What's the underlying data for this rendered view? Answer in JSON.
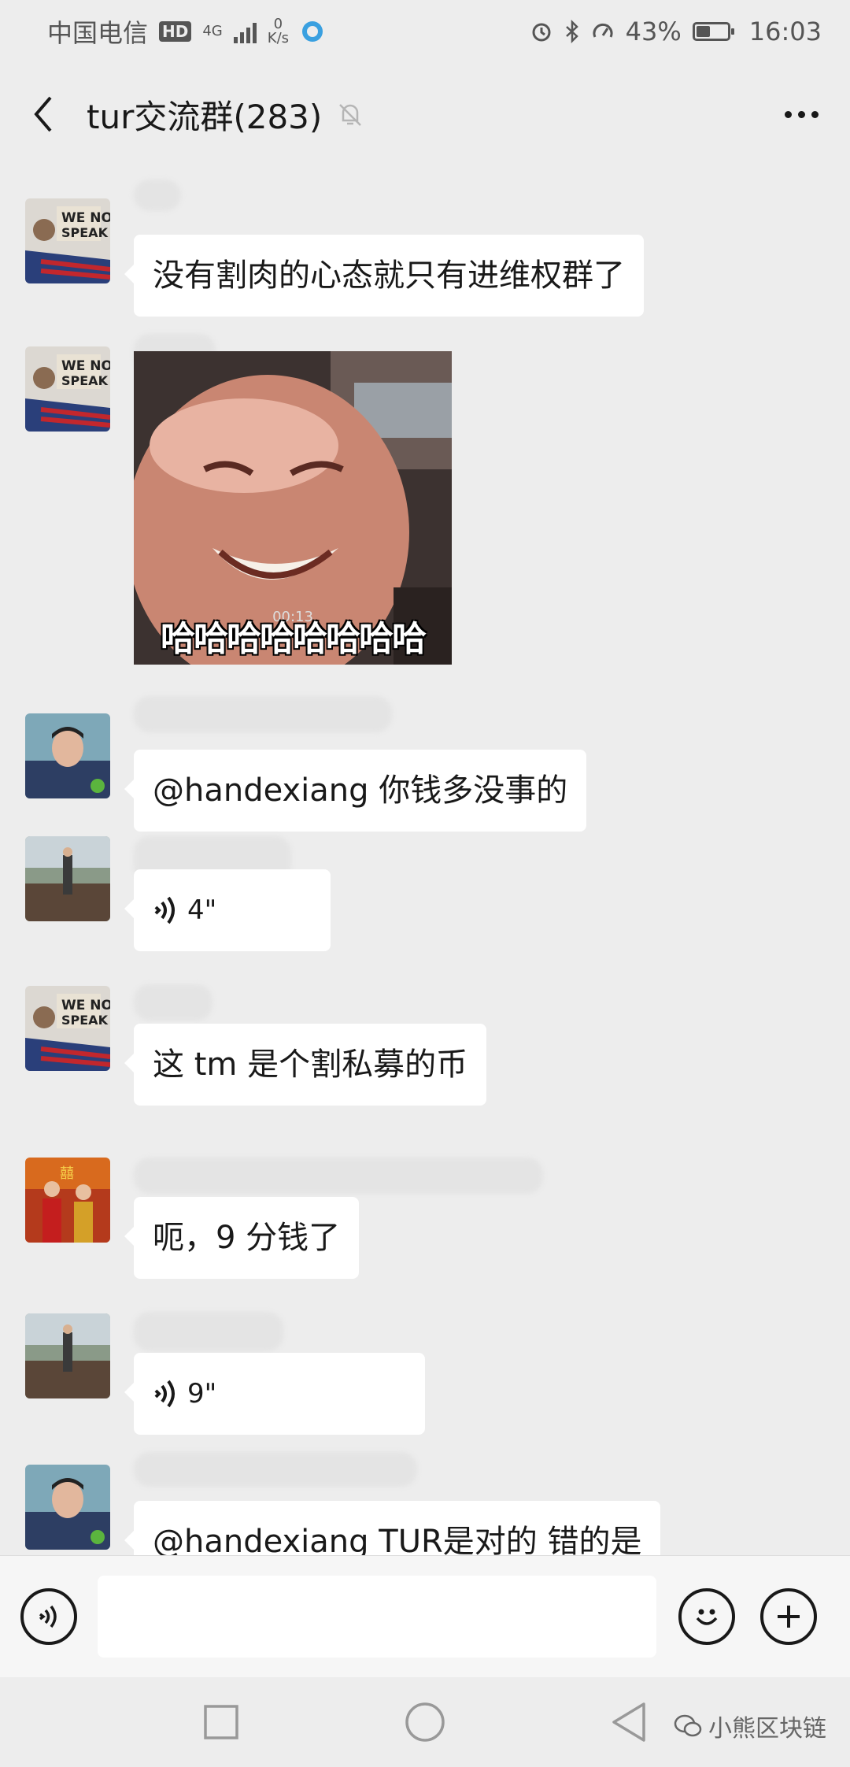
{
  "status_bar": {
    "carrier": "中国电信",
    "hd": "HD",
    "network": "4G",
    "speed_value": "0",
    "speed_unit": "K/s",
    "battery": "43%",
    "time": "16:03"
  },
  "header": {
    "title": "tur交流群(283)"
  },
  "messages": [
    {
      "type": "text",
      "text": "没有割肉的心态就只有进维权群了"
    },
    {
      "type": "image",
      "caption": "哈哈哈哈哈哈哈哈",
      "duration": "00:13"
    },
    {
      "type": "text",
      "text": "@handexiang  你钱多没事的"
    },
    {
      "type": "voice",
      "duration": "4\""
    },
    {
      "type": "text",
      "text": "这 tm 是个割私募的币"
    },
    {
      "type": "text",
      "text": "呃，9 分钱了"
    },
    {
      "type": "voice",
      "duration": "9\""
    },
    {
      "type": "text",
      "text": "@handexiang   TUR是对的  错的是"
    }
  ],
  "input": {
    "placeholder": ""
  },
  "watermark": {
    "text": "小熊区块链"
  },
  "icons": {
    "back": "chevron-left-icon",
    "mute": "bell-off-icon",
    "more": "more-horizontal-icon",
    "voice_input": "voice-input-icon",
    "emoji": "smile-icon",
    "plus": "plus-icon",
    "nav_recent": "square-icon",
    "nav_home": "circle-icon",
    "nav_back": "triangle-back-icon"
  },
  "colors": {
    "background": "#ededed",
    "bubble": "#ffffff",
    "text": "#191919"
  }
}
